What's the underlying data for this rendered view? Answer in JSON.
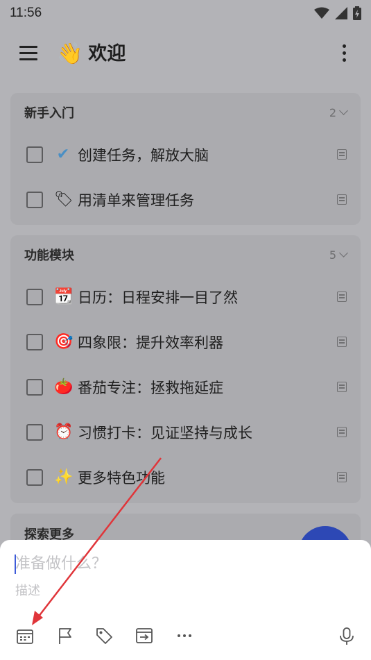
{
  "status_bar": {
    "time": "11:56"
  },
  "header": {
    "title": "欢迎",
    "title_emoji": "👋"
  },
  "sections": [
    {
      "title": "新手入门",
      "count": "2",
      "tasks": [
        {
          "emoji": "✔",
          "text": "创建任务，解放大脑"
        },
        {
          "emoji": "🏷",
          "text": "用清单来管理任务"
        }
      ]
    },
    {
      "title": "功能模块",
      "count": "5",
      "tasks": [
        {
          "emoji": "📆",
          "text": "日历：日程安排一目了然"
        },
        {
          "emoji": "🎯",
          "text": "四象限：提升效率利器"
        },
        {
          "emoji": "🍅",
          "text": "番茄专注：拯救拖延症"
        },
        {
          "emoji": "⏰",
          "text": "习惯打卡：见证坚持与成长"
        },
        {
          "emoji": "✨",
          "text": "更多特色功能"
        }
      ]
    },
    {
      "title": "探索更多"
    }
  ],
  "add_task": {
    "title_placeholder": "准备做什么？",
    "desc_placeholder": "描述",
    "toolbar": [
      "calendar-icon",
      "flag-icon",
      "tag-icon",
      "move-to-list-icon",
      "more-icon",
      "microphone-icon"
    ]
  },
  "colors": {
    "accent": "#3d5bd9",
    "fab": "#2d48b5",
    "annotation_arrow": "#e0353a"
  }
}
